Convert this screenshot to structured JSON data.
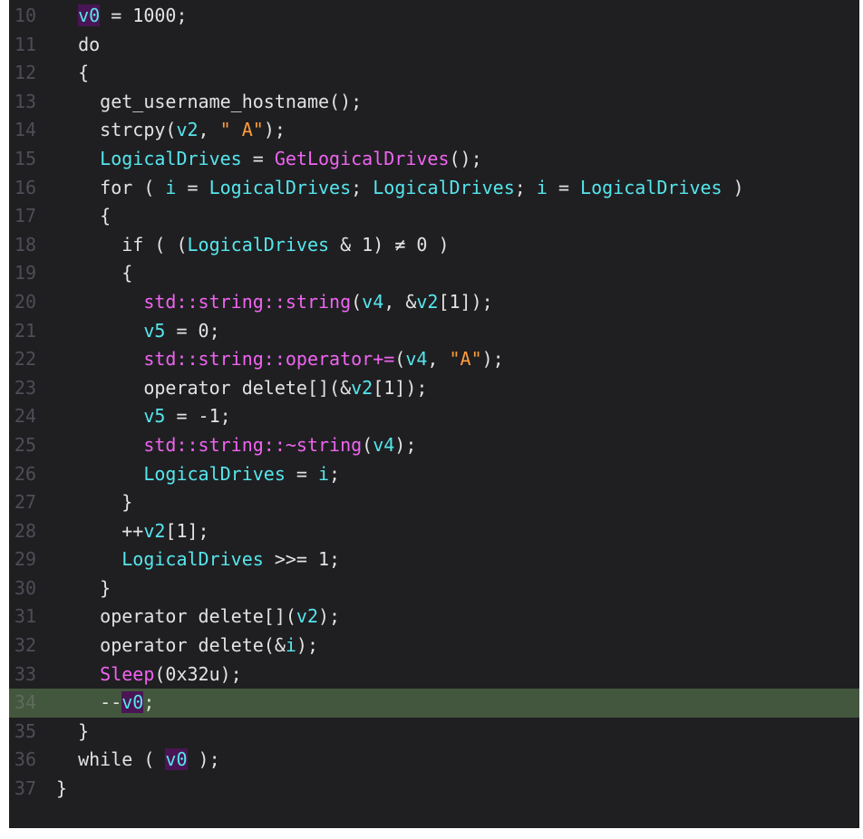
{
  "editor": {
    "theme_colors": {
      "background": "#1f1f22",
      "highlight_line": "#43573e",
      "line_number": "#4d4d55",
      "variable": "#55e6ec",
      "global_variable_bg": "#4a1554",
      "function": "#ef64ef",
      "string": "#ff9d3b",
      "plain": "#e2e2e2"
    },
    "highlighted_line": "34",
    "lines": [
      {
        "num": "10",
        "tokens": [
          {
            "t": "  ",
            "c": "pl"
          },
          {
            "t": "v0",
            "c": "gvar"
          },
          {
            "t": " = 1000;",
            "c": "pl"
          }
        ]
      },
      {
        "num": "11",
        "tokens": [
          {
            "t": "  do",
            "c": "kw"
          }
        ]
      },
      {
        "num": "12",
        "tokens": [
          {
            "t": "  {",
            "c": "pl"
          }
        ]
      },
      {
        "num": "13",
        "tokens": [
          {
            "t": "    get_username_hostname();",
            "c": "pl"
          }
        ]
      },
      {
        "num": "14",
        "tokens": [
          {
            "t": "    strcpy(",
            "c": "pl"
          },
          {
            "t": "v2",
            "c": "var"
          },
          {
            "t": ", ",
            "c": "pl"
          },
          {
            "t": "\" A\"",
            "c": "str"
          },
          {
            "t": ");",
            "c": "pl"
          }
        ]
      },
      {
        "num": "15",
        "tokens": [
          {
            "t": "    ",
            "c": "pl"
          },
          {
            "t": "LogicalDrives",
            "c": "var"
          },
          {
            "t": " = ",
            "c": "pl"
          },
          {
            "t": "GetLogicalDrives",
            "c": "fn"
          },
          {
            "t": "();",
            "c": "pl"
          }
        ]
      },
      {
        "num": "16",
        "tokens": [
          {
            "t": "    for ( ",
            "c": "pl"
          },
          {
            "t": "i",
            "c": "var"
          },
          {
            "t": " = ",
            "c": "pl"
          },
          {
            "t": "LogicalDrives",
            "c": "var"
          },
          {
            "t": "; ",
            "c": "pl"
          },
          {
            "t": "LogicalDrives",
            "c": "var"
          },
          {
            "t": "; ",
            "c": "pl"
          },
          {
            "t": "i",
            "c": "var"
          },
          {
            "t": " = ",
            "c": "pl"
          },
          {
            "t": "LogicalDrives",
            "c": "var"
          },
          {
            "t": " )",
            "c": "pl"
          }
        ]
      },
      {
        "num": "17",
        "tokens": [
          {
            "t": "    {",
            "c": "pl"
          }
        ]
      },
      {
        "num": "18",
        "tokens": [
          {
            "t": "      if ( (",
            "c": "pl"
          },
          {
            "t": "LogicalDrives",
            "c": "var"
          },
          {
            "t": " & 1) ≠ 0 )",
            "c": "pl"
          }
        ]
      },
      {
        "num": "19",
        "tokens": [
          {
            "t": "      {",
            "c": "pl"
          }
        ]
      },
      {
        "num": "20",
        "tokens": [
          {
            "t": "        ",
            "c": "pl"
          },
          {
            "t": "std::string::string",
            "c": "fn"
          },
          {
            "t": "(",
            "c": "pl"
          },
          {
            "t": "v4",
            "c": "var"
          },
          {
            "t": ", &",
            "c": "pl"
          },
          {
            "t": "v2",
            "c": "var"
          },
          {
            "t": "[1]);",
            "c": "pl"
          }
        ]
      },
      {
        "num": "21",
        "tokens": [
          {
            "t": "        ",
            "c": "pl"
          },
          {
            "t": "v5",
            "c": "var"
          },
          {
            "t": " = 0;",
            "c": "pl"
          }
        ]
      },
      {
        "num": "22",
        "tokens": [
          {
            "t": "        ",
            "c": "pl"
          },
          {
            "t": "std::string::operator+=",
            "c": "fn"
          },
          {
            "t": "(",
            "c": "pl"
          },
          {
            "t": "v4",
            "c": "var"
          },
          {
            "t": ", ",
            "c": "pl"
          },
          {
            "t": "\"A\"",
            "c": "str"
          },
          {
            "t": ");",
            "c": "pl"
          }
        ]
      },
      {
        "num": "23",
        "tokens": [
          {
            "t": "        operator delete[](&",
            "c": "pl"
          },
          {
            "t": "v2",
            "c": "var"
          },
          {
            "t": "[1]);",
            "c": "pl"
          }
        ]
      },
      {
        "num": "24",
        "tokens": [
          {
            "t": "        ",
            "c": "pl"
          },
          {
            "t": "v5",
            "c": "var"
          },
          {
            "t": " = -1;",
            "c": "pl"
          }
        ]
      },
      {
        "num": "25",
        "tokens": [
          {
            "t": "        ",
            "c": "pl"
          },
          {
            "t": "std::string::~string",
            "c": "fn"
          },
          {
            "t": "(",
            "c": "pl"
          },
          {
            "t": "v4",
            "c": "var"
          },
          {
            "t": ");",
            "c": "pl"
          }
        ]
      },
      {
        "num": "26",
        "tokens": [
          {
            "t": "        ",
            "c": "pl"
          },
          {
            "t": "LogicalDrives",
            "c": "var"
          },
          {
            "t": " = ",
            "c": "pl"
          },
          {
            "t": "i",
            "c": "var"
          },
          {
            "t": ";",
            "c": "pl"
          }
        ]
      },
      {
        "num": "27",
        "tokens": [
          {
            "t": "      }",
            "c": "pl"
          }
        ]
      },
      {
        "num": "28",
        "tokens": [
          {
            "t": "      ++",
            "c": "pl"
          },
          {
            "t": "v2",
            "c": "var"
          },
          {
            "t": "[1];",
            "c": "pl"
          }
        ]
      },
      {
        "num": "29",
        "tokens": [
          {
            "t": "      ",
            "c": "pl"
          },
          {
            "t": "LogicalDrives",
            "c": "var"
          },
          {
            "t": " >>= 1;",
            "c": "pl"
          }
        ]
      },
      {
        "num": "30",
        "tokens": [
          {
            "t": "    }",
            "c": "pl"
          }
        ]
      },
      {
        "num": "31",
        "tokens": [
          {
            "t": "    operator delete[](",
            "c": "pl"
          },
          {
            "t": "v2",
            "c": "var"
          },
          {
            "t": ");",
            "c": "pl"
          }
        ]
      },
      {
        "num": "32",
        "tokens": [
          {
            "t": "    operator delete(&",
            "c": "pl"
          },
          {
            "t": "i",
            "c": "var"
          },
          {
            "t": ");",
            "c": "pl"
          }
        ]
      },
      {
        "num": "33",
        "tokens": [
          {
            "t": "    ",
            "c": "pl"
          },
          {
            "t": "Sleep",
            "c": "fn"
          },
          {
            "t": "(0x32u);",
            "c": "pl"
          }
        ]
      },
      {
        "num": "34",
        "tokens": [
          {
            "t": "    --",
            "c": "pl"
          },
          {
            "t": "v0",
            "c": "gvar"
          },
          {
            "t": ";",
            "c": "pl"
          }
        ]
      },
      {
        "num": "35",
        "tokens": [
          {
            "t": "  }",
            "c": "pl"
          }
        ]
      },
      {
        "num": "36",
        "tokens": [
          {
            "t": "  while ( ",
            "c": "pl"
          },
          {
            "t": "v0",
            "c": "gvar"
          },
          {
            "t": " );",
            "c": "pl"
          }
        ]
      },
      {
        "num": "37",
        "tokens": [
          {
            "t": "}",
            "c": "pl"
          }
        ]
      }
    ]
  }
}
